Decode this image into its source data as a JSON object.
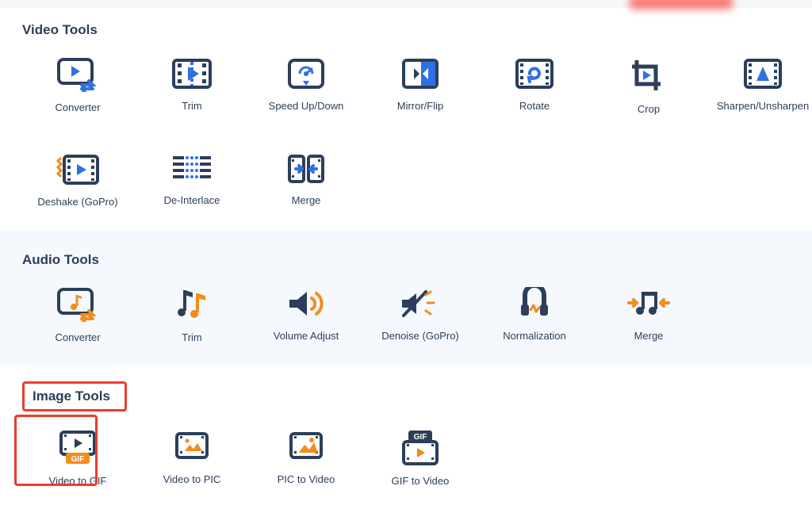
{
  "sections": {
    "video": {
      "title": "Video Tools",
      "items": [
        {
          "label": "Converter"
        },
        {
          "label": "Trim"
        },
        {
          "label": "Speed Up/Down"
        },
        {
          "label": "Mirror/Flip"
        },
        {
          "label": "Rotate"
        },
        {
          "label": "Crop"
        },
        {
          "label": "Sharpen/Unsharpen"
        },
        {
          "label": "Deshake (GoPro)"
        },
        {
          "label": "De-Interlace"
        },
        {
          "label": "Merge"
        }
      ]
    },
    "audio": {
      "title": "Audio Tools",
      "items": [
        {
          "label": "Converter"
        },
        {
          "label": "Trim"
        },
        {
          "label": "Volume Adjust"
        },
        {
          "label": "Denoise (GoPro)"
        },
        {
          "label": "Normalization"
        },
        {
          "label": "Merge"
        }
      ]
    },
    "image": {
      "title": "Image Tools",
      "items": [
        {
          "label": "Video to GIF"
        },
        {
          "label": "Video to PIC"
        },
        {
          "label": "PIC to Video"
        },
        {
          "label": "GIF to Video"
        }
      ]
    }
  },
  "colors": {
    "navy": "#2c3e5a",
    "blue": "#2e71e5",
    "orange": "#f28c1a"
  }
}
